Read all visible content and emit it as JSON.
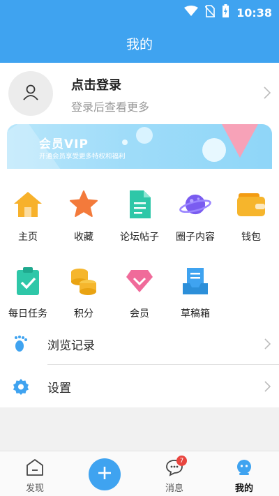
{
  "statusbar": {
    "time": "10:38",
    "icons": [
      "wifi-icon",
      "no-sim-icon",
      "battery-charging-icon"
    ]
  },
  "header": {
    "title": "我的"
  },
  "profile": {
    "title": "点击登录",
    "subtitle": "登录后查看更多",
    "avatar_icon": "user-icon"
  },
  "vip": {
    "title": "会员VIP",
    "subtitle": "开通会员享受更多特权和福利"
  },
  "grid": [
    {
      "label": "主页",
      "icon": "home-icon",
      "color": "#f7b12b"
    },
    {
      "label": "收藏",
      "icon": "star-icon",
      "color": "#f37a3b"
    },
    {
      "label": "论坛帖子",
      "icon": "document-icon",
      "color": "#2ec7a8"
    },
    {
      "label": "圈子内容",
      "icon": "planet-icon",
      "color": "#7a5cf0"
    },
    {
      "label": "钱包",
      "icon": "wallet-icon",
      "color": "#f6b52c"
    },
    {
      "label": "每日任务",
      "icon": "clipboard-check-icon",
      "color": "#2ec7a8"
    },
    {
      "label": "积分",
      "icon": "coins-icon",
      "color": "#f5b62d"
    },
    {
      "label": "会员",
      "icon": "diamond-icon",
      "color": "#f06b9a"
    },
    {
      "label": "草稿箱",
      "icon": "drafts-icon",
      "color": "#3fa3f0"
    }
  ],
  "menu": [
    {
      "label": "浏览记录",
      "icon": "footprint-icon"
    },
    {
      "label": "设置",
      "icon": "gear-icon"
    }
  ],
  "tabbar": {
    "items": [
      {
        "label": "发现",
        "icon": "discover-icon"
      },
      {
        "label": "",
        "icon": "plus-icon"
      },
      {
        "label": "消息",
        "icon": "message-icon",
        "badge": "7"
      },
      {
        "label": "我的",
        "icon": "mine-icon"
      }
    ]
  },
  "colors": {
    "primary": "#3fa3f0",
    "badge": "#e9453f",
    "vip_pink": "#f7a2b8"
  }
}
